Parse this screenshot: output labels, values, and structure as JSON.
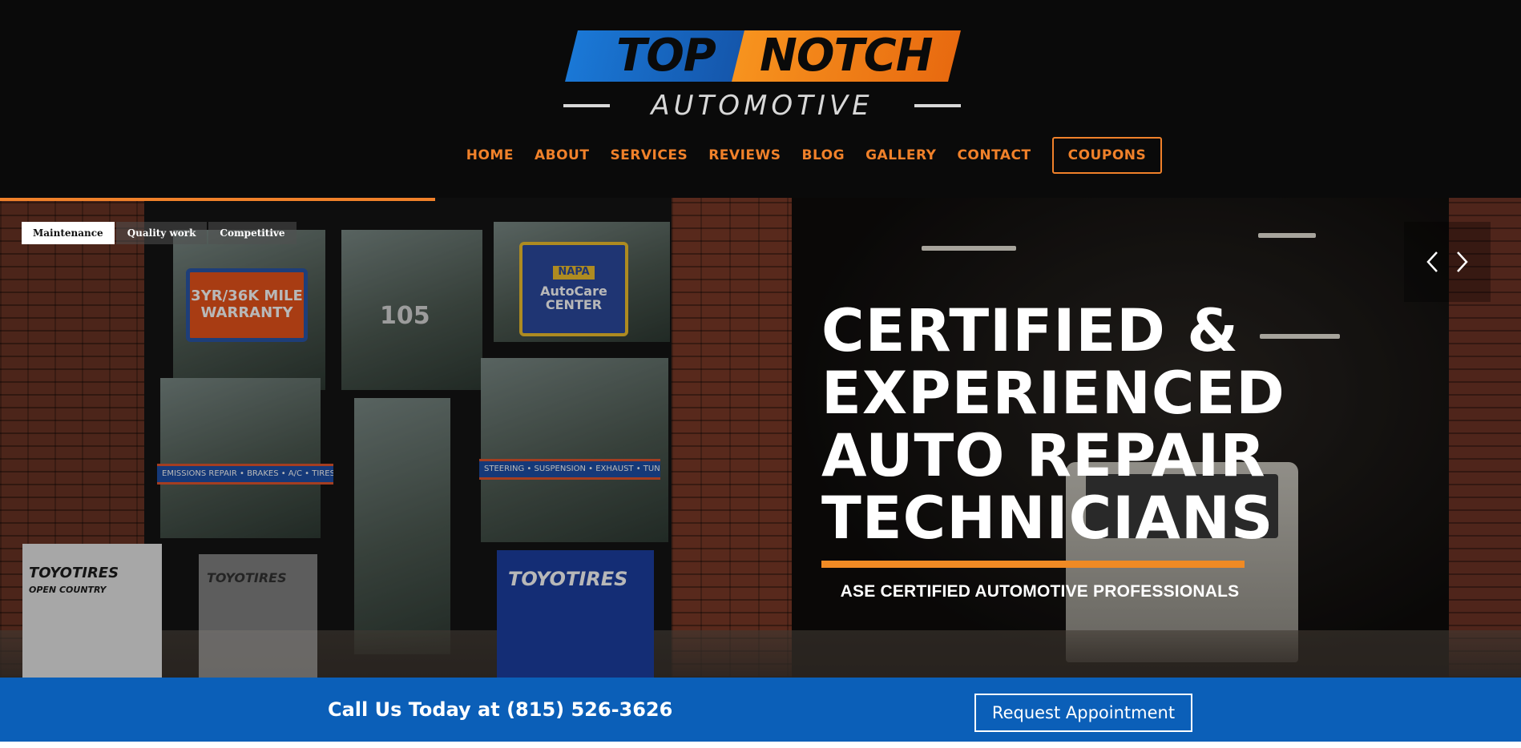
{
  "header": {
    "logo": {
      "word_1": "TOP",
      "word_2": "NOTCH",
      "subtitle": "AUTOMOTIVE"
    },
    "nav": [
      {
        "label": "HOME"
      },
      {
        "label": "ABOUT"
      },
      {
        "label": "SERVICES"
      },
      {
        "label": "REVIEWS"
      },
      {
        "label": "BLOG"
      },
      {
        "label": "GALLERY"
      },
      {
        "label": "CONTACT"
      },
      {
        "label": "COUPONS"
      }
    ]
  },
  "hero": {
    "slide_tabs": [
      {
        "label": "Maintenance",
        "active": true
      },
      {
        "label": "Quality work",
        "active": false
      },
      {
        "label": "Competitive",
        "active": false
      }
    ],
    "arrows": {
      "prev_icon": "chevron-left-icon",
      "next_icon": "chevron-right-icon"
    },
    "title_lines": [
      "CERTIFIED &",
      "EXPERIENCED",
      "AUTO REPAIR",
      "TECHNICIANS"
    ],
    "subtitle": "ASE CERTIFIED AUTOMOTIVE PROFESSIONALS",
    "photo": {
      "warranty_sign": "3YR/36K MILE WARRANTY",
      "napa_sign": {
        "mark": "NAPA",
        "text": "AutoCare CENTER"
      },
      "address_number": "105",
      "strip_left": "EMISSIONS REPAIR • BRAKES • A/C • TIRES",
      "strip_right": "STEERING • SUSPENSION • EXHAUST • TUNE UPS",
      "tire_banner_1": "TOYOTIRES",
      "tire_banner_1_sub": "OPEN COUNTRY",
      "tire_banner_2": "TOYOTIRES",
      "tire_banner_3": "TOYOTIRES"
    }
  },
  "call_bar": {
    "text": "Call Us Today at (815) 526-3626",
    "button_label": "Request Appointment"
  },
  "colors": {
    "accent_orange": "#f0812a",
    "header_bg": "#0a0a0a",
    "call_bar_bg": "#0b5fb8",
    "logo_blue": "#1a78d6"
  }
}
